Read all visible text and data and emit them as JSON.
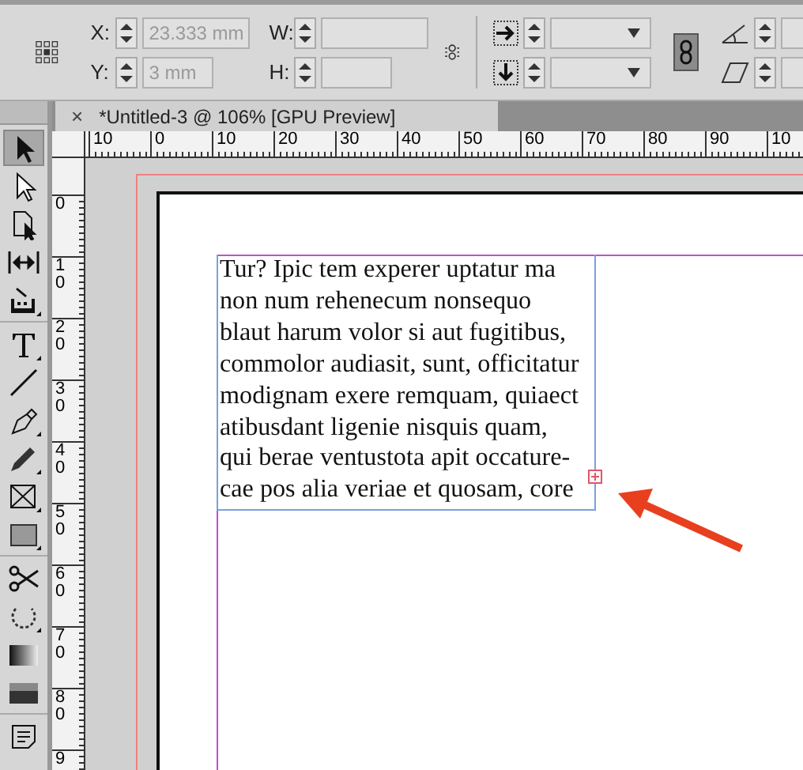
{
  "control_bar": {
    "fields": [
      {
        "label": "X:",
        "value": "23.333 mm"
      },
      {
        "label": "W:"
      },
      {
        "label": "Y:",
        "value": "3 mm"
      },
      {
        "label": "H:"
      }
    ],
    "constrain": {
      "on": true
    }
  },
  "document_tab": {
    "close": "×",
    "title": "*Untitled-3 @ 106% [GPU Preview]"
  },
  "tools": [
    {
      "kind": "selection",
      "selected": true,
      "flyout": false
    },
    {
      "kind": "direct",
      "selected": false,
      "flyout": false
    },
    {
      "kind": "page",
      "selected": false,
      "flyout": false
    },
    {
      "kind": "gap",
      "selected": false,
      "flyout": false
    },
    {
      "kind": "collector",
      "selected": false,
      "flyout": true
    },
    {
      "kind": "type",
      "selected": false,
      "flyout": true
    },
    {
      "kind": "line",
      "selected": false,
      "flyout": false
    },
    {
      "kind": "pen",
      "selected": false,
      "flyout": true
    },
    {
      "kind": "pencil",
      "selected": false,
      "flyout": true
    },
    {
      "kind": "frame",
      "selected": false,
      "flyout": true
    },
    {
      "kind": "rectangle",
      "selected": false,
      "flyout": true
    },
    {
      "kind": "scissors",
      "selected": false,
      "flyout": false
    },
    {
      "kind": "transform",
      "selected": false,
      "flyout": true
    },
    {
      "kind": "gradient",
      "selected": false,
      "flyout": false
    },
    {
      "kind": "feather",
      "selected": false,
      "flyout": false
    },
    {
      "kind": "note",
      "selected": false,
      "flyout": false
    }
  ],
  "ruler_top": {
    "labels": [
      "10",
      "0",
      "10",
      "20",
      "30",
      "40",
      "50",
      "60",
      "70",
      "80",
      "90",
      "10"
    ]
  },
  "ruler_left": {
    "labels": [
      "0",
      "10",
      "20",
      "30",
      "40",
      "50",
      "60",
      "70",
      "80",
      "9"
    ]
  },
  "text_frame": {
    "lines": [
      "Tur? Ipic tem experer uptatur ma",
      "non num rehenecum nonsequo",
      "blaut harum volor si aut fugitibus,",
      "commolor audiasit, sunt, officitatur",
      "modignam exere remquam, quiaect",
      "atibusdant ligenie nisquis quam,",
      "qui berae ventustota apit occature-",
      "cae pos alia veriae et quosam, core"
    ],
    "overset": true
  }
}
